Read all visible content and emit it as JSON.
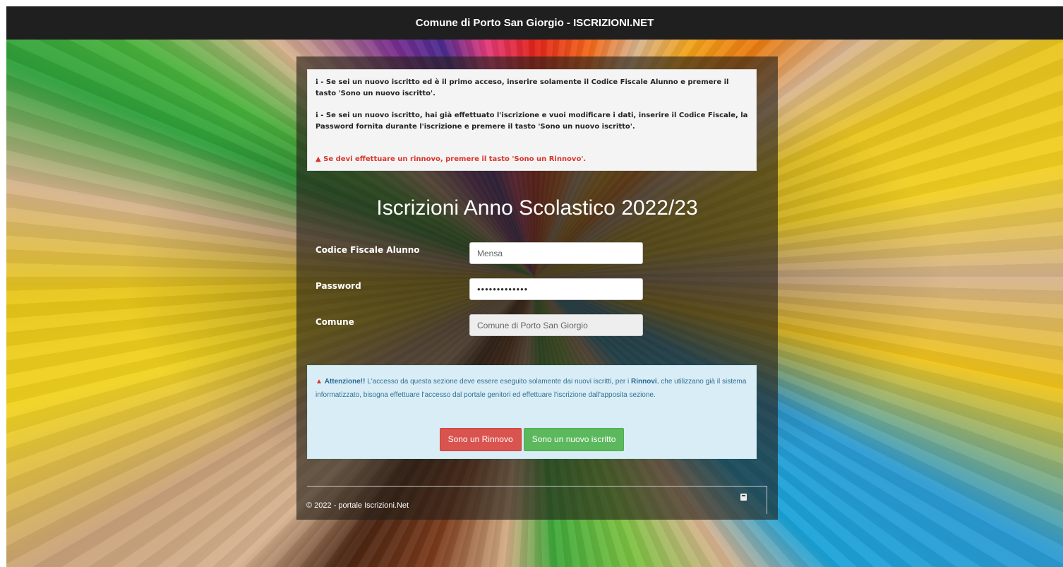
{
  "header": {
    "title": "Comune di Porto San Giorgio - ISCRIZIONI.NET"
  },
  "info": {
    "line1": "ℹ - Se sei un nuovo iscritto ed è il primo acceso, inserire solamente il Codice Fiscale Alunno e premere il tasto 'Sono un nuovo iscritto'.",
    "line2": "ℹ - Se sei un nuovo iscritto, hai già effettuato l'iscrizione e vuoi modificare i dati, inserire il Codice Fiscale, la Password fornita durante l'iscrizione e premere il tasto 'Sono un nuovo iscritto'.",
    "warning": "▲ Se devi effettuare un rinnovo, premere il tasto 'Sono un Rinnovo'."
  },
  "form": {
    "title": "Iscrizioni Anno Scolastico 2022/23",
    "codice_label": "Codice Fiscale Alunno",
    "codice_value": "Mensa",
    "password_label": "Password",
    "password_value": "•••••••••••••",
    "comune_label": "Comune",
    "comune_value": "Comune di Porto San Giorgio"
  },
  "alert": {
    "icon": "▲",
    "strong": "Attenzione!!",
    "text1": " L'accesso da questa sezione deve essere eseguito solamente dai nuovi iscritti, per i ",
    "rinnovi": "Rinnovi",
    "text2": ", che utilizzano già il sistema informatizzato, bisogna effettuare l'accesso dal portale genitori ed effettuare l'iscrizione dall'apposita sezione."
  },
  "buttons": {
    "rinnovo": "Sono un Rinnovo",
    "nuovo": "Sono un nuovo iscritto"
  },
  "footer": {
    "copyright": "© 2022 - portale Iscrizioni.Net"
  },
  "colors": {
    "danger": "#d9534f",
    "success": "#5cb85c",
    "info_bg": "#d9edf7",
    "topbar": "#1f1f1f"
  }
}
